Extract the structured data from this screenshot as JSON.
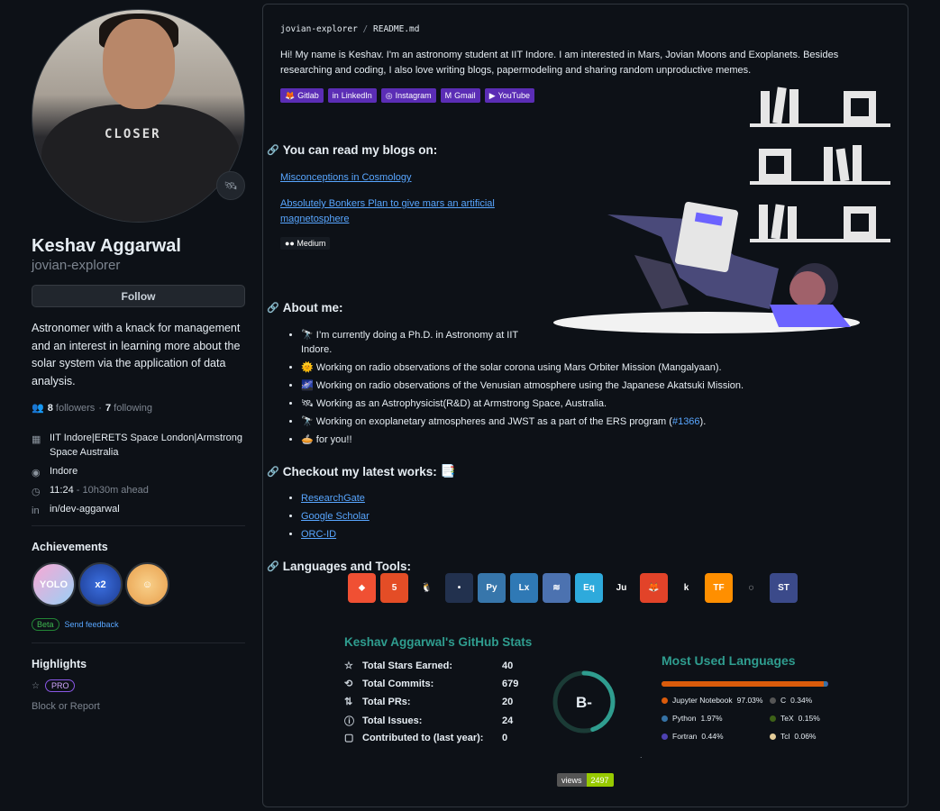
{
  "profile": {
    "name": "Keshav Aggarwal",
    "login": "jovian-explorer",
    "avatar_shirt_text": "CLOSER",
    "follow_label": "Follow",
    "bio": "Astronomer with a knack for management and an interest in learning more about the solar system via the application of data analysis.",
    "followers_count": "8",
    "followers_label": "followers",
    "following_count": "7",
    "following_label": "following",
    "separator": "·",
    "company": "IIT Indore|ERETS Space London|Armstrong Space Australia",
    "location": "Indore",
    "time": "11:24",
    "time_offset": "- 10h30m ahead",
    "linkedin": "in/dev-aggarwal",
    "achievements_title": "Achievements",
    "achievement_badges": [
      {
        "name": "yolo",
        "text": "YOLO",
        "color": "#f29ec8"
      },
      {
        "name": "shark",
        "text": "x2",
        "color": "#2f5fd0"
      },
      {
        "name": "cowboy",
        "text": "☺",
        "color": "#f2c27a"
      }
    ],
    "beta_label": "Beta",
    "feedback_label": "Send feedback",
    "highlights_title": "Highlights",
    "pro_label": "PRO",
    "block_label": "Block or Report"
  },
  "readme": {
    "path_owner": "jovian-explorer",
    "path_sep": "/",
    "path_file": "README.md",
    "intro": "Hi! My name is Keshav. I'm an astronomy student at IIT Indore. I am interested in Mars, Jovian Moons and Exoplanets. Besides researching and coding, I also love writing blogs, papermodeling and sharing random unproductive memes.",
    "shields": [
      {
        "name": "gitlab",
        "label": "Gitlab",
        "icon": "🦊"
      },
      {
        "name": "linkedin",
        "label": "LinkedIn",
        "icon": "in"
      },
      {
        "name": "instagram",
        "label": "Instagram",
        "icon": "◎"
      },
      {
        "name": "gmail",
        "label": "Gmail",
        "icon": "M"
      },
      {
        "name": "youtube",
        "label": "YouTube",
        "icon": "▶"
      }
    ],
    "blogs_heading": "You can read my blogs on:",
    "blog_links": [
      "Misconceptions in Cosmology",
      "Absolutely Bonkers Plan to give mars an artificial magnetosphere"
    ],
    "medium_label": "Medium",
    "about_heading": "About me:",
    "about_items": [
      {
        "emoji": "🔭",
        "text": "I’m currently doing a Ph.D. in Astronomy at IIT Indore."
      },
      {
        "emoji": "🌞",
        "text": "Working on radio observations of the solar corona using Mars Orbiter Mission (Mangalyaan)."
      },
      {
        "emoji": "🌌",
        "text": "Working on radio observations of the Venusian atmosphere using the Japanese Akatsuki Mission."
      },
      {
        "emoji": "🛰",
        "text": "Working as an Astrophysicist(R&D) at Armstrong Space, Australia."
      },
      {
        "emoji": "🔭",
        "text": "Working on exoplanetary atmospheres and JWST as a part of the ERS program (",
        "link": "#1366",
        "after": ")."
      },
      {
        "emoji": "🥧",
        "text": "for you!!"
      }
    ],
    "works_heading": "Checkout my latest works:",
    "works_emoji": "📑",
    "works_links": [
      "ResearchGate",
      "Google Scholar",
      "ORC-ID"
    ],
    "tools_heading": "Languages and Tools:",
    "tools": [
      {
        "name": "git",
        "text": "⬥",
        "color": "#f05033"
      },
      {
        "name": "html5",
        "text": "5",
        "color": "#e44d26"
      },
      {
        "name": "linux",
        "text": "🐧",
        "color": "transparent"
      },
      {
        "name": "ros",
        "text": "•",
        "color": "#22314e"
      },
      {
        "name": "python",
        "text": "Py",
        "color": "#3776ab"
      },
      {
        "name": "latex",
        "text": "Lx",
        "color": "#2f79b5"
      },
      {
        "name": "seaborn",
        "text": "≋",
        "color": "#4c72b0"
      },
      {
        "name": "eureqa",
        "text": "Eq",
        "color": "#2eaadc"
      },
      {
        "name": "julia",
        "text": "Ju",
        "color": "transparent"
      },
      {
        "name": "gitlab",
        "text": "🦊",
        "color": "#e24329"
      },
      {
        "name": "kotlin",
        "text": "k",
        "color": "transparent"
      },
      {
        "name": "tensorflow",
        "text": "TF",
        "color": "#ff8f00"
      },
      {
        "name": "pytorch",
        "text": "◌",
        "color": "transparent"
      },
      {
        "name": "sastrano",
        "text": "ST",
        "color": "#3b4a8a"
      }
    ],
    "stats": {
      "title": "Keshav Aggarwal's GitHub Stats",
      "rows": [
        {
          "icon": "☆",
          "label": "Total Stars Earned:",
          "value": "40"
        },
        {
          "icon": "⟲",
          "label": "Total Commits:",
          "value": "679"
        },
        {
          "icon": "⇅",
          "label": "Total PRs:",
          "value": "20"
        },
        {
          "icon": "ⓘ",
          "label": "Total Issues:",
          "value": "24"
        },
        {
          "icon": "▢",
          "label": "Contributed to (last year):",
          "value": "0"
        }
      ],
      "grade": "B-",
      "grade_ring_fraction": 0.45,
      "ring_color": "#2f9d8f"
    },
    "languages": {
      "title": "Most Used Languages",
      "items": [
        {
          "name": "Jupyter Notebook",
          "percent": "97.03%",
          "value": 97.03,
          "color": "#DA5B0B"
        },
        {
          "name": "C",
          "percent": "0.34%",
          "value": 0.34,
          "color": "#555555"
        },
        {
          "name": "Python",
          "percent": "1.97%",
          "value": 1.97,
          "color": "#3572A5"
        },
        {
          "name": "TeX",
          "percent": "0.15%",
          "value": 0.15,
          "color": "#3D6117"
        },
        {
          "name": "Fortran",
          "percent": "0.44%",
          "value": 0.44,
          "color": "#4d41b1"
        },
        {
          "name": "Tcl",
          "percent": "0.06%",
          "value": 0.06,
          "color": "#e4cc98"
        }
      ]
    },
    "views": {
      "label": "views",
      "count": "2497"
    },
    "small_text": "."
  }
}
